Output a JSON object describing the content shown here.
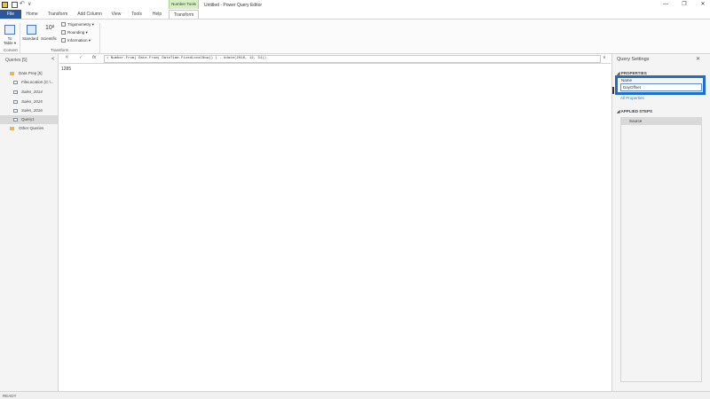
{
  "titlebar": {
    "window_title": "Untitled - Power Query Editor",
    "context_tab_header": "Number Tools",
    "quick_access_dropdown": "∨",
    "controls": {
      "minimize": "—",
      "maximize": "❐",
      "close": "✕"
    }
  },
  "ribbon_tabs": [
    {
      "label": "File",
      "selected": false
    },
    {
      "label": "Home",
      "selected": false
    },
    {
      "label": "Transform",
      "selected": false
    },
    {
      "label": "Add Column",
      "selected": false
    },
    {
      "label": "View",
      "selected": false
    },
    {
      "label": "Tools",
      "selected": false
    },
    {
      "label": "Help",
      "selected": false
    },
    {
      "label": "Transform",
      "selected": true
    }
  ],
  "ribbon": {
    "to_table_label": "To Table ▾",
    "standard_label": "Standard",
    "scientific_label": "Scientific",
    "scientific_glyph": "10²",
    "trigonometry_label": "Trigonometry ▾",
    "rounding_label": "Rounding ▾",
    "information_label": "Information ▾",
    "group_convert": "Convert",
    "group_transform": "Transform"
  },
  "queries_pane": {
    "header": "Queries [5]",
    "collapse_glyph": "<",
    "items": [
      {
        "label": "Data Prep [5]",
        "type": "folder",
        "italic": false
      },
      {
        "label": "FileLocation (C:\\...",
        "type": "parameter",
        "italic": true
      },
      {
        "label": "Sales_2014",
        "type": "table",
        "italic": true
      },
      {
        "label": "Sales_2015",
        "type": "table",
        "italic": true
      },
      {
        "label": "Sales_2016",
        "type": "table",
        "italic": true
      },
      {
        "label": "Query1",
        "type": "query",
        "italic": false,
        "selected": true
      },
      {
        "label": "Other Queries",
        "type": "folder",
        "italic": false
      }
    ]
  },
  "formula_bar": {
    "cancel_glyph": "✕",
    "commit_glyph": "✓",
    "fx_glyph": "fx",
    "formula": "= Number.From( Date.From( DateTime.FixedLocalNow() ) - #date(2016, 12, 31))",
    "expand_glyph": "∨"
  },
  "result": {
    "value": "1285"
  },
  "query_settings": {
    "title": "Query Settings",
    "close_glyph": "✕",
    "properties_header": "◢ PROPERTIES",
    "name_label": "Name",
    "name_value": "DayOffset",
    "all_properties_link": "All Properties",
    "applied_steps_header": "◢ APPLIED STEPS",
    "steps": [
      "Source"
    ]
  },
  "status": {
    "text": "READY"
  },
  "colors": {
    "file_tab": "#2b579a",
    "context_tab": "#d6f0c4",
    "highlight": "#1f6ec3"
  },
  "icons": [
    "powerbi-logo-icon",
    "save-icon",
    "undo-icon",
    "folder-icon",
    "table-icon",
    "parameter-icon",
    "query-icon",
    "fx-icon"
  ]
}
